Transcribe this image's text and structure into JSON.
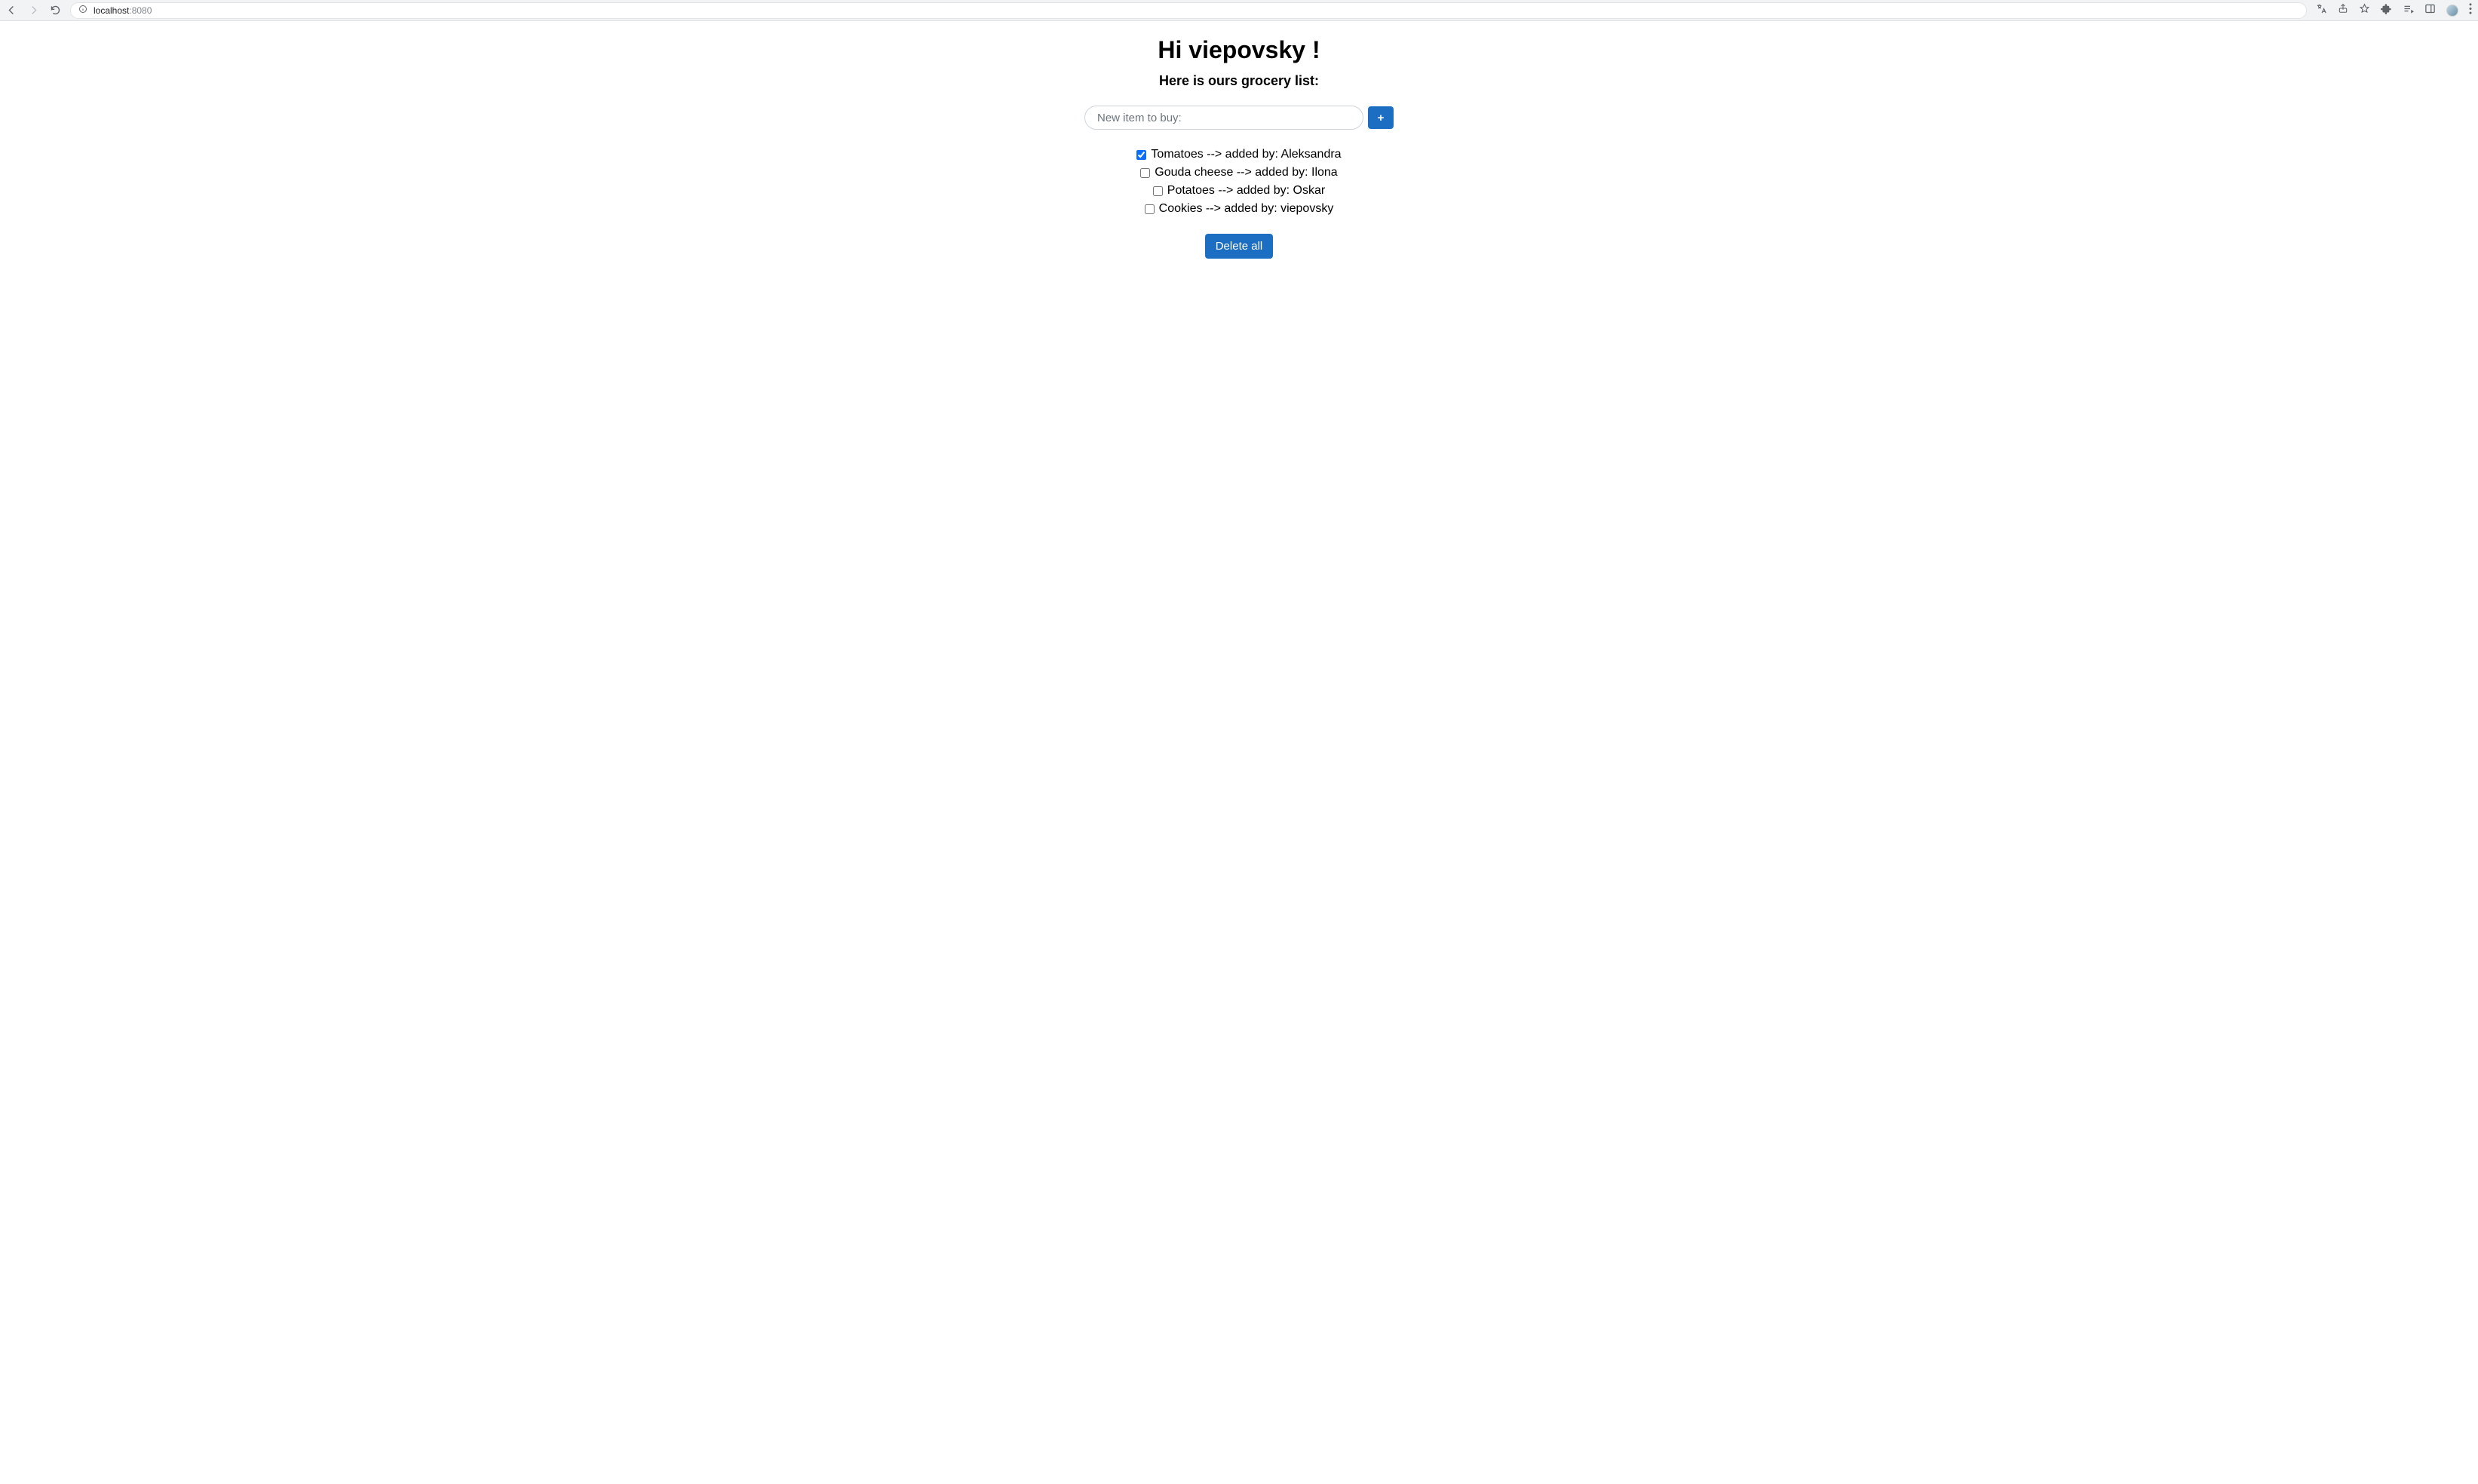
{
  "browser": {
    "host": "localhost",
    "port": ":8080"
  },
  "header": {
    "title": "Hi viepovsky !",
    "subtitle": "Here is ours grocery list:"
  },
  "input": {
    "placeholder": "New item to buy:",
    "add_label": "+"
  },
  "list": {
    "items": [
      {
        "label": "Tomatoes --> added by: Aleksandra",
        "checked": true
      },
      {
        "label": "Gouda cheese --> added by: Ilona",
        "checked": false
      },
      {
        "label": "Potatoes --> added by: Oskar",
        "checked": false
      },
      {
        "label": "Cookies --> added by: viepovsky",
        "checked": false
      }
    ]
  },
  "actions": {
    "delete_all": "Delete all"
  }
}
